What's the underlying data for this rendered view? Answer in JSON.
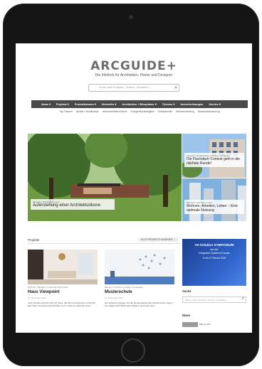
{
  "site": {
    "logo": "ARCGUIDE+",
    "tagline": "Die Infothek für Architekten, Planer und Designer",
    "search_placeholder": "Suche nach Projekten, Themen, Herstellern ..."
  },
  "nav": {
    "items": [
      "News ▾",
      "Projekte ▾",
      "Produktwissen ▾",
      "Hersteller ▾",
      "Architekten + Büroplaner ▾",
      "Themen ▾",
      "Ausschreibungen",
      "Service ▾"
    ],
    "subitems": [
      "Top-Themen",
      "Akustik / Schallschutz",
      "Innenarchitektur/Interior",
      "Energie/Nachhaltigkeit",
      "Gebäudehülle",
      "Wohnentwicklung",
      "Bauwerksbedachung"
    ]
  },
  "hero": {
    "main": {
      "meta": "aktuelles | Wohnbau | Leben",
      "title": "Auferstehung einer Architekturikone"
    },
    "side1": {
      "meta": "aktuelles | Wettbewerbe | Arbeiten und Bauen",
      "title": "Die Flachdach Contest geht in die nächste Runde!"
    },
    "side2": {
      "meta": "Bürobau | Wohnbau | Lehre",
      "title": "Wohnen, Arbeiten, Leben – Eine optimale Nutzung"
    }
  },
  "projects": {
    "section_title": "Projekte",
    "more_label": "ALLE PROJEKTE ANSEHEN →",
    "cards": [
      {
        "meta": "Wohnen | Stuttgart | Karlsruhe Polis Group",
        "title": "Haus Viewpoint",
        "date": "23. November 2017",
        "text": "Jede Familie wünscht sich ein Haus, das ihren Ansprüchen entspricht. Das Haus Viewpoint gibt Einblick in ein modernes Wohnkonzept ..."
      },
      {
        "meta": "Bildung | Frankfurt am Main | Architekten",
        "title": "Musterschule",
        "date": "21. November 2017",
        "text": "Der Erweiterungsbau und die Neugestaltung der Musterschule zeigen, wie zeitgemäße Bildungsarchitektur aussehen kann ..."
      }
    ]
  },
  "sidebar": {
    "ad": {
      "title": "AV-Solution SYMPOSIUM",
      "sub1": "auf der",
      "sub2": "Integrated Systems Europe",
      "date": "6. bis 9. Februar 2018"
    },
    "search_heading": "Suche",
    "search_placeholder": "Suche nach Projekten, Themen, Herstellern",
    "news_heading": "News",
    "news_item": "Wer is nun?"
  },
  "colors": {
    "navbar": "#4a4a4a",
    "ad_blue": "#2f63c9",
    "tablet_frame": "#141414"
  }
}
